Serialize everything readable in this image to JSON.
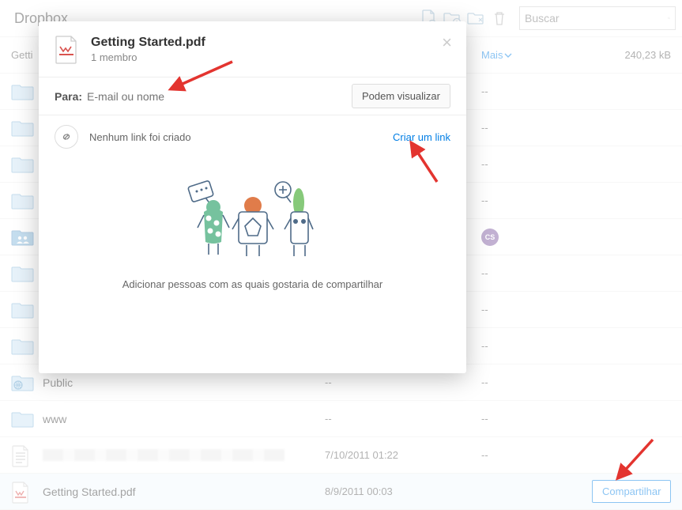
{
  "header": {
    "title": "Dropbox",
    "search_placeholder": "Buscar"
  },
  "list_header": {
    "kind_visible_text": "Getti",
    "more_label": "Mais",
    "size_text": "240,23 kB"
  },
  "rows": [
    {
      "name": "",
      "mod": "--",
      "members": "--",
      "shared": false
    },
    {
      "name": "",
      "mod": "--",
      "members": "--",
      "shared": false
    },
    {
      "name": "",
      "mod": "--",
      "members": "--",
      "shared": false
    },
    {
      "name": "",
      "mod": "--",
      "members": "--",
      "shared": false
    },
    {
      "name": "",
      "mod": "--",
      "members": "avatar",
      "shared": true,
      "avatar": "CS"
    },
    {
      "name": "",
      "mod": "--",
      "members": "--",
      "shared": false
    },
    {
      "name": "",
      "mod": "--",
      "members": "--",
      "shared": false
    },
    {
      "name": "",
      "mod": "--",
      "members": "--",
      "shared": false
    },
    {
      "name": "Public",
      "mod": "--",
      "members": "--",
      "shared": false,
      "globe": true
    },
    {
      "name": "www",
      "mod": "--",
      "members": "--",
      "shared": false
    }
  ],
  "doc_rows": [
    {
      "name_blurred": true,
      "mod": "7/10/2011 01:22",
      "members": "--",
      "file": true
    },
    {
      "name": "Getting Started.pdf",
      "mod": "8/9/2011 00:03",
      "members": "",
      "file": true,
      "pdf": true,
      "selected": true,
      "share_label": "Compartilhar"
    }
  ],
  "modal": {
    "title": "Getting Started.pdf",
    "subtitle": "1 membro",
    "para_label": "Para:",
    "para_placeholder": "E-mail ou nome",
    "view_label": "Podem visualizar",
    "no_link_text": "Nenhum link foi criado",
    "create_link": "Criar um link",
    "caption": "Adicionar pessoas com as quais gostaria de compartilhar"
  }
}
